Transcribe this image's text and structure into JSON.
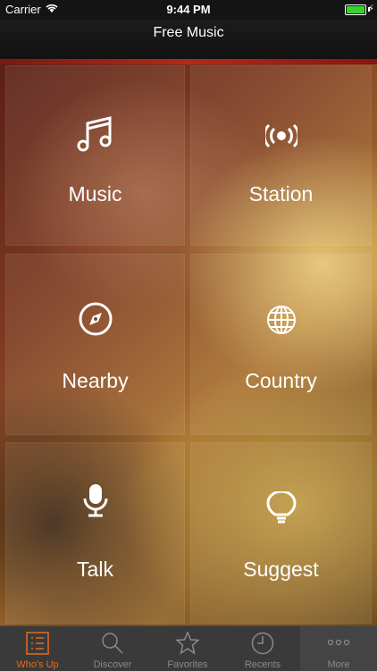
{
  "status": {
    "carrier": "Carrier",
    "time": "9:44 PM"
  },
  "nav": {
    "title": "Free Music"
  },
  "tiles": [
    {
      "label": "Music",
      "icon": "music-note-icon"
    },
    {
      "label": "Station",
      "icon": "broadcast-icon"
    },
    {
      "label": "Nearby",
      "icon": "compass-icon"
    },
    {
      "label": "Country",
      "icon": "globe-icon"
    },
    {
      "label": "Talk",
      "icon": "microphone-icon"
    },
    {
      "label": "Suggest",
      "icon": "lightbulb-icon"
    }
  ],
  "tabs": [
    {
      "label": "Who's Up",
      "icon": "list-icon",
      "active": true
    },
    {
      "label": "Discover",
      "icon": "search-icon"
    },
    {
      "label": "Favorites",
      "icon": "star-icon"
    },
    {
      "label": "Recents",
      "icon": "clock-icon"
    },
    {
      "label": "More",
      "icon": "more-dots-icon"
    }
  ],
  "colors": {
    "accent": "#e86a1c",
    "battery": "#37d22f"
  }
}
